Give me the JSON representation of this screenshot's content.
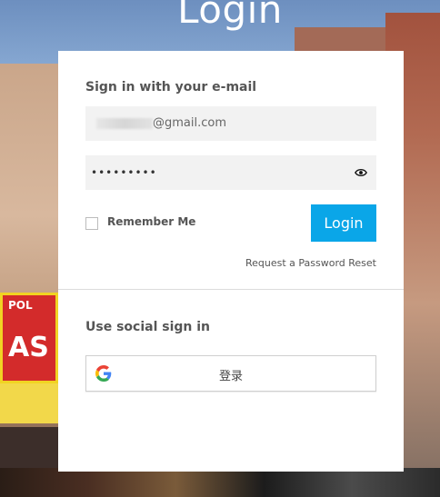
{
  "page": {
    "title": "Login"
  },
  "signin": {
    "heading": "Sign in with your e-mail",
    "email_value": "@gmail.com",
    "password_value": "•••••••••",
    "remember_label": "Remember Me",
    "login_label": "Login",
    "reset_link": "Request a Password Reset"
  },
  "social": {
    "heading": "Use social sign in",
    "google_label": "登录"
  },
  "colors": {
    "accent": "#0aa6e8",
    "card_bg": "#ffffff",
    "field_bg": "#f2f2f2"
  },
  "icons": {
    "password_toggle": "eye-icon",
    "social_provider": "google-icon"
  }
}
